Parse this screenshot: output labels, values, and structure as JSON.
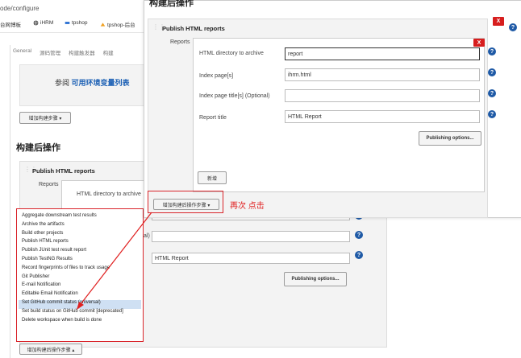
{
  "browser": {
    "url": "ode/configure",
    "bookmarks": [
      {
        "label": "台网博板",
        "icon": "none"
      },
      {
        "label": "iHRM",
        "icon": "globe-icon"
      },
      {
        "label": "tpshop",
        "icon": "tpshop-icon"
      },
      {
        "label": "tpshop-后台",
        "icon": "tpshop-admin-icon"
      }
    ]
  },
  "config": {
    "tabs": [
      "General",
      "源码管理",
      "构建触发器",
      "构建"
    ],
    "env_hint_prefix": "参阅",
    "env_hint_link": "可用环境变量列表",
    "add_build_step": "增加构建步骤 ▾",
    "post_build_heading": "构建后操作",
    "section_title": "Publish HTML reports",
    "reports_label": "Reports",
    "dir_label": "HTML directory to archive",
    "index_value": "ihrm.html",
    "title_label_fragment": "al)",
    "report_title_value": "HTML Report",
    "publishing_options": "Publishing options...",
    "add_post_build_step": "增加构建后操作步骤 ▴"
  },
  "dropdown": {
    "items": [
      "Aggregate downstream test results",
      "Archive the artifacts",
      "Build other projects",
      "Publish HTML reports",
      "Publish JUnit test result report",
      "Publish TestNG Results",
      "Record fingerprints of files to track usage",
      "Git Publisher",
      "E-mail Notification",
      "Editable Email Notification",
      "Set GitHub commit status (universal)",
      "Set build status on GitHub commit [deprecated]",
      "Delete workspace when build is done"
    ],
    "highlighted": "Editable Email Notification"
  },
  "popup": {
    "heading": "构建后操作",
    "section_title": "Publish HTML reports",
    "reports_label": "Reports",
    "dir_label": "HTML directory to archive",
    "dir_value": "report",
    "index_label": "Index page[s]",
    "index_value": "ihrm.html",
    "index_title_label": "Index page title[s] (Optional)",
    "index_title_value": "",
    "report_title_label": "Report title",
    "report_title_value": "HTML Report",
    "publishing_options": "Publishing options...",
    "add_button": "新增",
    "add_post_build_step": "增加构建后操作步骤 ▾",
    "close_x": "X"
  },
  "annotation": {
    "text": "再次 点击",
    "color": "#e02020"
  }
}
